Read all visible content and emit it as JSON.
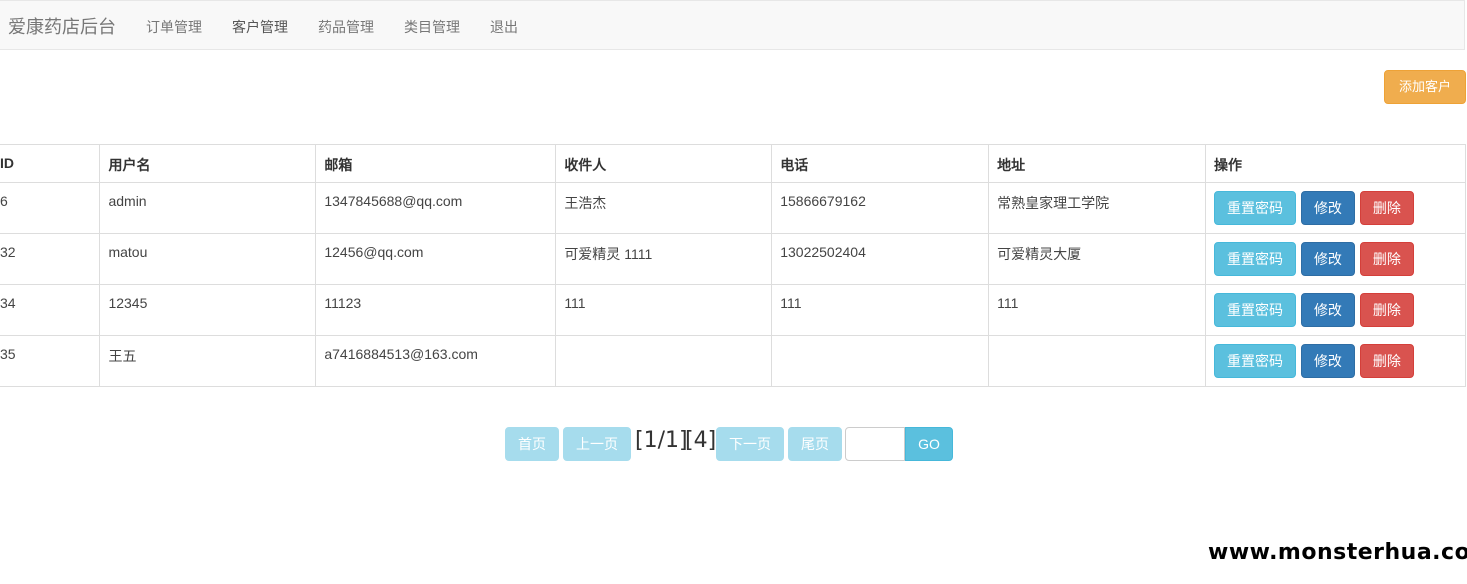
{
  "nav": {
    "brand": "爱康药店后台",
    "items": [
      {
        "label": "订单管理"
      },
      {
        "label": "客户管理"
      },
      {
        "label": "药品管理"
      },
      {
        "label": "类目管理"
      },
      {
        "label": "退出"
      }
    ]
  },
  "toolbar": {
    "add_label": "添加客户"
  },
  "table": {
    "columns": [
      "ID",
      "用户名",
      "邮箱",
      "收件人",
      "电话",
      "地址",
      "操作"
    ],
    "rows": [
      {
        "id": "6",
        "username": "admin",
        "email": "1347845688@qq.com",
        "recipient": "王浩杰",
        "phone": "15866679162",
        "address": "常熟皇家理工学院"
      },
      {
        "id": "32",
        "username": "matou",
        "email": "12456@qq.com",
        "recipient": "可爱精灵 1111",
        "phone": "13022502404",
        "address": "可爱精灵大厦"
      },
      {
        "id": "34",
        "username": "12345",
        "email": "11123",
        "recipient": "111",
        "phone": "111",
        "address": "111"
      },
      {
        "id": "35",
        "username": "王五",
        "email": "a7416884513@163.com",
        "recipient": "",
        "phone": "",
        "address": ""
      }
    ],
    "actions": {
      "reset": "重置密码",
      "edit": "修改",
      "delete": "删除"
    }
  },
  "pager": {
    "first": "首页",
    "prev": "上一页",
    "page_info": "[1/1]",
    "total": "[4]",
    "next": "下一页",
    "last": "尾页",
    "jump_value": "",
    "go": "GO"
  },
  "watermark": "www.monsterhua.com",
  "colors": {
    "warning": "#f0ad4e",
    "info": "#5bc0de",
    "primary": "#337ab7",
    "danger": "#d9534f",
    "pager_disabled": "#a6dced"
  }
}
